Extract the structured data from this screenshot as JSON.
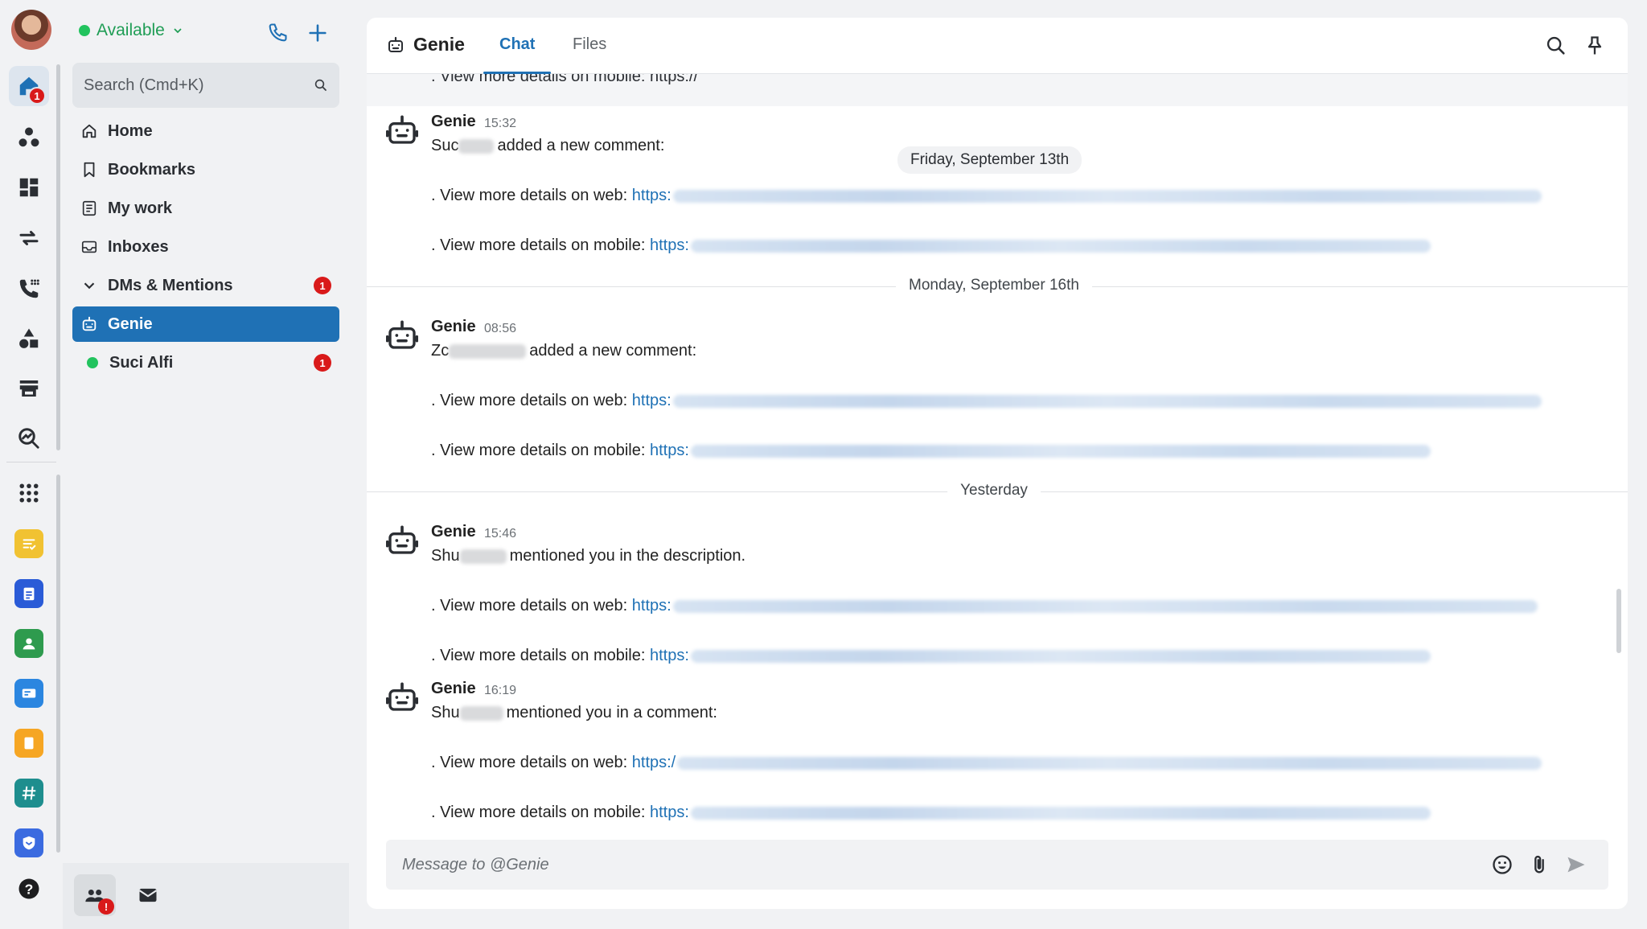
{
  "rail": {
    "home_badge": "1",
    "apps": [
      {
        "name": "notes-app-icon",
        "color": "#f1c232"
      },
      {
        "name": "clipboard-app-icon",
        "color": "#2a5bd7"
      },
      {
        "name": "people-app-icon",
        "color": "#2e9b4e"
      },
      {
        "name": "card-app-icon",
        "color": "#2b86e0"
      },
      {
        "name": "document-app-icon",
        "color": "#f6a623"
      },
      {
        "name": "hashtag-app-icon",
        "color": "#1e8e8e"
      },
      {
        "name": "shield-app-icon",
        "color": "#3b6be0"
      }
    ]
  },
  "sidebar": {
    "status": "Available",
    "search_placeholder": "Search (Cmd+K)",
    "nav": [
      {
        "label": "Home"
      },
      {
        "label": "Bookmarks"
      },
      {
        "label": "My work"
      },
      {
        "label": "Inboxes"
      }
    ],
    "dms_section": {
      "label": "DMs & Mentions",
      "badge": "1"
    },
    "dms": [
      {
        "label": "Genie",
        "selected": true
      },
      {
        "label": "Suci Alfi",
        "badge": "1"
      }
    ],
    "footer_badge": "!"
  },
  "header": {
    "channel": "Genie",
    "tabs": [
      "Chat",
      "Files"
    ],
    "active_tab": "Chat"
  },
  "feed": {
    "cut_line": ". View more details on mobile: https://",
    "floating_date": "Friday, September 13th",
    "dividers": [
      "Monday, September 16th",
      "Yesterday"
    ],
    "messages": [
      {
        "author": "Genie",
        "time": "15:32",
        "who_prefix": "Suc",
        "text": "added a new comment:",
        "web_label": ". View more details on web:",
        "web_link": "https:",
        "mobile_label": ". View more details on mobile:",
        "mobile_link": "https:"
      },
      {
        "author": "Genie",
        "time": "08:56",
        "who_prefix": "Zc",
        "text": "added a new comment:",
        "web_label": ". View more details on web:",
        "web_link": "https:",
        "mobile_label": ". View more details on mobile:",
        "mobile_link": "https:"
      },
      {
        "author": "Genie",
        "time": "15:46",
        "who_prefix": "Shu",
        "text": "mentioned you in the description.",
        "web_label": ". View more details on web:",
        "web_link": "https:",
        "mobile_label": ". View more details on mobile:",
        "mobile_link": "https:"
      },
      {
        "author": "Genie",
        "time": "16:19",
        "who_prefix": "Shu",
        "text": "mentioned you in a comment:",
        "web_label": ". View more details on web:",
        "web_link": "https:/",
        "mobile_label": ". View more details on mobile:",
        "mobile_link": "https:"
      }
    ]
  },
  "composer": {
    "placeholder": "Message to @Genie"
  }
}
